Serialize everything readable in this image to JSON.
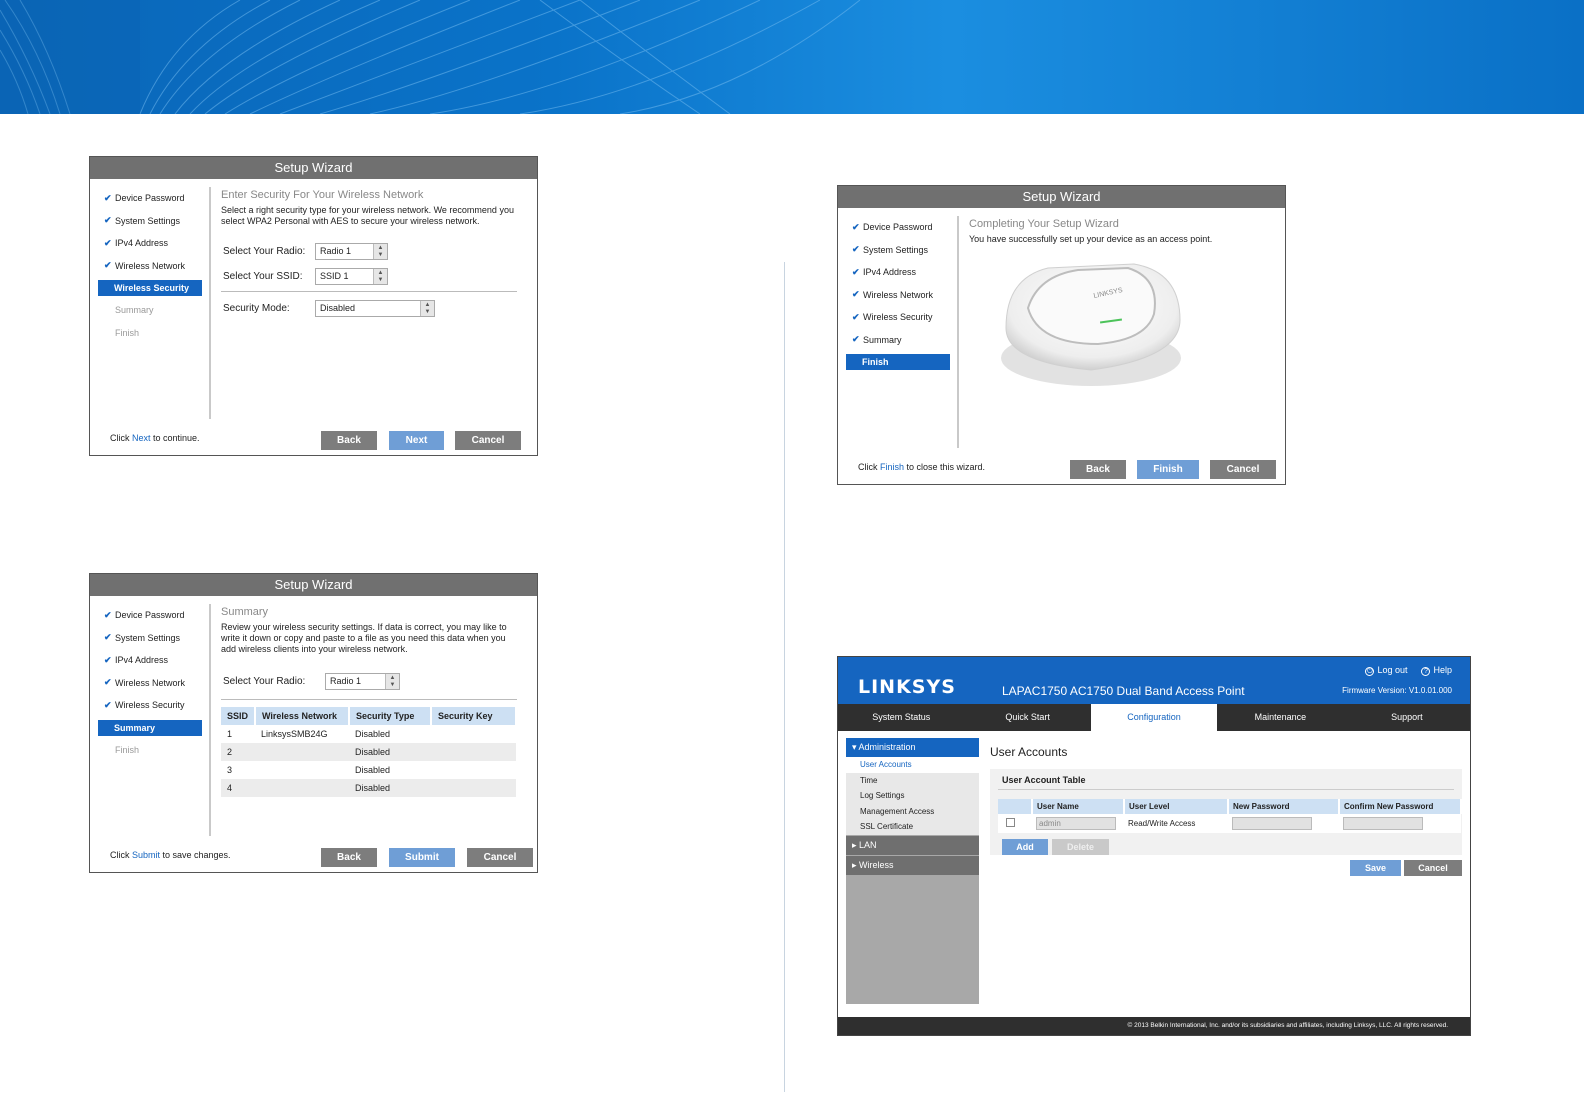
{
  "colors": {
    "accent": "#1565c0",
    "title_bar": "#707070",
    "button_gray": "#7d7d7d",
    "button_blue": "#6f9ed6"
  },
  "wizard1": {
    "title": "Setup Wizard",
    "steps": [
      "Device Password",
      "System Settings",
      "IPv4 Address",
      "Wireless Network",
      "Wireless Security",
      "Summary",
      "Finish"
    ],
    "heading": "Enter Security For Your Wireless Network",
    "desc": "Select a right security type for your wireless network. We recommend you select WPA2 Personal with AES to secure your wireless network.",
    "radio_label": "Select Your Radio:",
    "radio_value": "Radio 1",
    "ssid_label": "Select Your SSID:",
    "ssid_value": "SSID 1",
    "mode_label": "Security Mode:",
    "mode_value": "Disabled",
    "footer_pre": "Click ",
    "footer_hl": "Next",
    "footer_post": " to continue.",
    "back": "Back",
    "next": "Next",
    "cancel": "Cancel"
  },
  "wizard2": {
    "title": "Setup Wizard",
    "steps": [
      "Device Password",
      "System Settings",
      "IPv4 Address",
      "Wireless Network",
      "Wireless Security",
      "Summary",
      "Finish"
    ],
    "heading": "Summary",
    "desc": "Review your wireless security settings. If data is correct, you may like to write it down or copy and paste to a file as you need this data when you add wireless clients into your wireless network.",
    "radio_label": "Select Your Radio:",
    "radio_value": "Radio 1",
    "table": {
      "headers": [
        "SSID",
        "Wireless Network",
        "Security Type",
        "Security Key"
      ],
      "rows": [
        [
          "1",
          "LinksysSMB24G",
          "Disabled",
          ""
        ],
        [
          "2",
          "",
          "Disabled",
          ""
        ],
        [
          "3",
          "",
          "Disabled",
          ""
        ],
        [
          "4",
          "",
          "Disabled",
          ""
        ]
      ]
    },
    "footer_pre": "Click ",
    "footer_hl": "Submit",
    "footer_post": " to save changes.",
    "back": "Back",
    "submit": "Submit",
    "cancel": "Cancel"
  },
  "wizard3": {
    "title": "Setup Wizard",
    "steps": [
      "Device Password",
      "System Settings",
      "IPv4 Address",
      "Wireless Network",
      "Wireless Security",
      "Summary",
      "Finish"
    ],
    "heading": "Completing Your Setup Wizard",
    "desc": "You have successfully set up your device as an access point.",
    "router_brand": "LINKSYS",
    "footer_pre": "Click ",
    "footer_hl": "Finish",
    "footer_post": " to close this wizard.",
    "back": "Back",
    "finish": "Finish",
    "cancel": "Cancel"
  },
  "config": {
    "logo": "LINKSYS",
    "product": "LAPAC1750 AC1750 Dual Band Access Point",
    "logout": "Log out",
    "help": "Help",
    "firmware": "Firmware Version: V1.0.01.000",
    "tabs": [
      "System Status",
      "Quick Start",
      "Configuration",
      "Maintenance",
      "Support"
    ],
    "side": {
      "admin": "Administration",
      "admin_items": [
        "User Accounts",
        "Time",
        "Log Settings",
        "Management Access",
        "SSL Certificate"
      ],
      "lan": "LAN",
      "wireless": "Wireless"
    },
    "page_title": "User Accounts",
    "table_title": "User Account Table",
    "table_headers": [
      "",
      "User Name",
      "User Level",
      "New Password",
      "Confirm New Password"
    ],
    "row": {
      "user": "admin",
      "level": "Read/Write Access"
    },
    "add": "Add",
    "delete": "Delete",
    "save": "Save",
    "cancel": "Cancel",
    "footer": "© 2013 Belkin International, Inc. and/or its subsidiaries and affiliates, including Linksys, LLC. All rights reserved."
  }
}
